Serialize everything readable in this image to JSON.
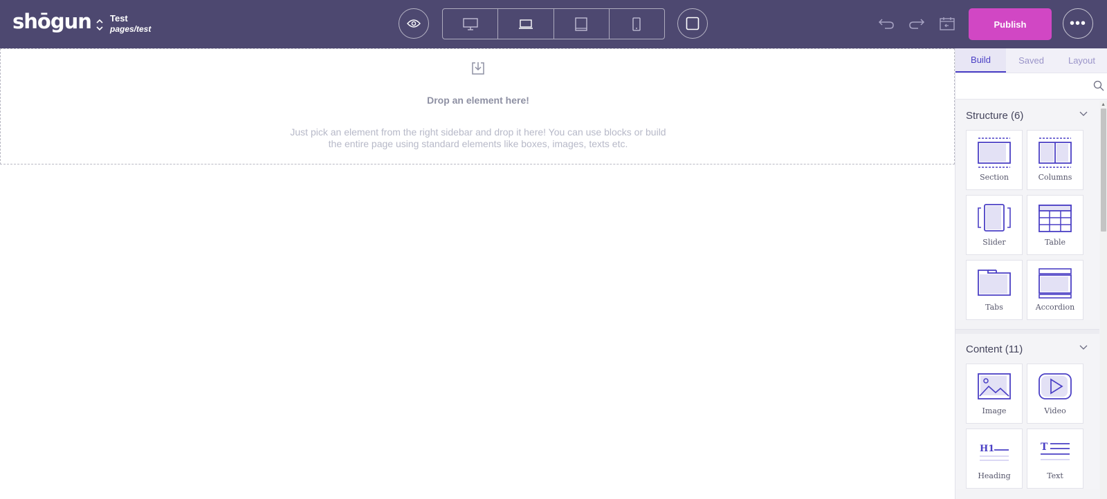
{
  "header": {
    "logo": "shōgun",
    "page_title": "Test",
    "page_path": "pages/test",
    "publish_label": "Publish",
    "more_label": "•••"
  },
  "canvas": {
    "drop_title": "Drop an element here!",
    "drop_desc_line1": "Just pick an element from the right sidebar and drop it here! You can use blocks or build",
    "drop_desc_line2": "the entire page using standard elements like boxes, images, texts etc."
  },
  "sidebar": {
    "tabs": [
      "Build",
      "Saved",
      "Layout"
    ],
    "structure": {
      "title": "Structure (6)",
      "items": [
        "Section",
        "Columns",
        "Slider",
        "Table",
        "Tabs",
        "Accordion"
      ]
    },
    "content": {
      "title": "Content (11)",
      "items": [
        "Image",
        "Video",
        "Heading",
        "Text"
      ]
    }
  },
  "colors": {
    "topbar": "#4d4870",
    "publish": "#d147c4",
    "accent": "#4a3fc5"
  }
}
